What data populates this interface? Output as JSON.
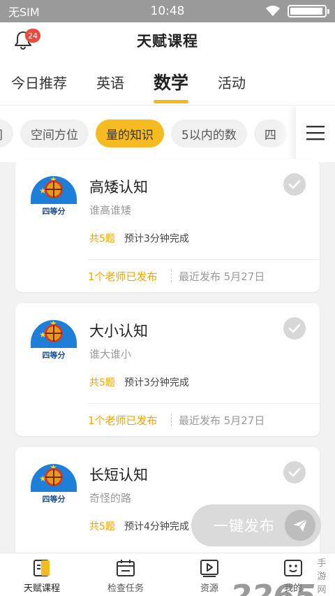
{
  "status_bar": {
    "carrier": "无SIM",
    "time": "10:48",
    "battery_level": 0.95
  },
  "header": {
    "title": "天赋课程",
    "notification_count": "24"
  },
  "category_tabs": [
    {
      "label": "今日推荐",
      "active": false
    },
    {
      "label": "英语",
      "active": false
    },
    {
      "label": "数学",
      "active": true
    },
    {
      "label": "活动",
      "active": false
    }
  ],
  "sub_chips": [
    {
      "label": "间",
      "active": false
    },
    {
      "label": "空间方位",
      "active": false
    },
    {
      "label": "量的知识",
      "active": true
    },
    {
      "label": "5以内的数",
      "active": false
    },
    {
      "label": "四",
      "active": false
    }
  ],
  "cards": [
    {
      "thumb_caption": "四等分",
      "title": "高矮认知",
      "subtitle": "谁高谁矮",
      "count": "共5题",
      "estimate": "预计3分钟完成",
      "teachers": "1个老师已发布",
      "recent": "最近发布 5月27日"
    },
    {
      "thumb_caption": "四等分",
      "title": "大小认知",
      "subtitle": "谁大谁小",
      "count": "共5题",
      "estimate": "预计3分钟完成",
      "teachers": "1个老师已发布",
      "recent": "最近发布 5月27日"
    },
    {
      "thumb_caption": "四等分",
      "title": "长短认知",
      "subtitle": "奇怪的路",
      "count": "共5题",
      "estimate": "预计4分钟完成",
      "teachers": "",
      "recent": ""
    }
  ],
  "publish_button": {
    "label": "一键发布"
  },
  "bottom_nav": [
    {
      "label": "天赋课程",
      "icon": "book-icon",
      "active": true
    },
    {
      "label": "检查任务",
      "icon": "calendar-icon",
      "active": false
    },
    {
      "label": "资源",
      "icon": "video-icon",
      "active": false
    },
    {
      "label": "我的",
      "icon": "profile-icon",
      "active": false
    }
  ],
  "watermark": {
    "big": "2265",
    "small": "手游网"
  },
  "colors": {
    "accent": "#f7bb22",
    "orange_text": "#f0a500",
    "status_bar": "#9a9a9a"
  }
}
